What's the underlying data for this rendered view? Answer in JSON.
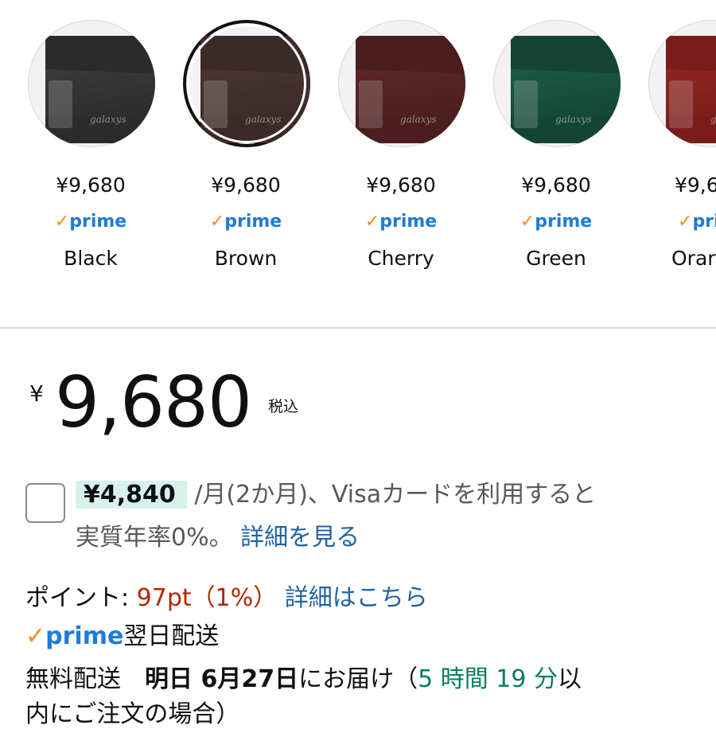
{
  "variants": [
    {
      "name": "Black",
      "price": "¥9,680",
      "prime": "prime",
      "color": "#2b2b2b",
      "flap": "#3a3a3a",
      "selected": false
    },
    {
      "name": "Brown",
      "price": "¥9,680",
      "prime": "prime",
      "color": "#3a2a28",
      "flap": "#4a3431",
      "selected": true
    },
    {
      "name": "Cherry",
      "price": "¥9,680",
      "prime": "prime",
      "color": "#4a1e1e",
      "flap": "#5c2626",
      "selected": false
    },
    {
      "name": "Green",
      "price": "¥9,680",
      "prime": "prime",
      "color": "#144534",
      "flap": "#1b5a44",
      "selected": false
    },
    {
      "name": "Orar",
      "price": "¥9,6",
      "prime": "pri",
      "color": "#7a1d1a",
      "flap": "#8d2522",
      "selected": false
    }
  ],
  "brand_mark": "galaxys",
  "price": {
    "currency": "¥",
    "amount": "9,680",
    "tax_label": "税込"
  },
  "installment": {
    "amount": "¥4,840",
    "text_line1": " /月(2か月)、Visaカードを利用すると",
    "text_line2": "実質年率0%。",
    "link": "詳細を見る"
  },
  "points": {
    "label": "ポイント:",
    "value": "97pt（1%）",
    "link": "詳細はこちら"
  },
  "prime_delivery": {
    "check": "✓",
    "word": "prime",
    "text": "翌日配送"
  },
  "delivery": {
    "prefix": "無料配送　",
    "date": "明日 6月27日",
    "mid": "にお届け（",
    "time": "5 時間 19 分",
    "suffix": "以",
    "line2": "内にご注文の場合）"
  }
}
